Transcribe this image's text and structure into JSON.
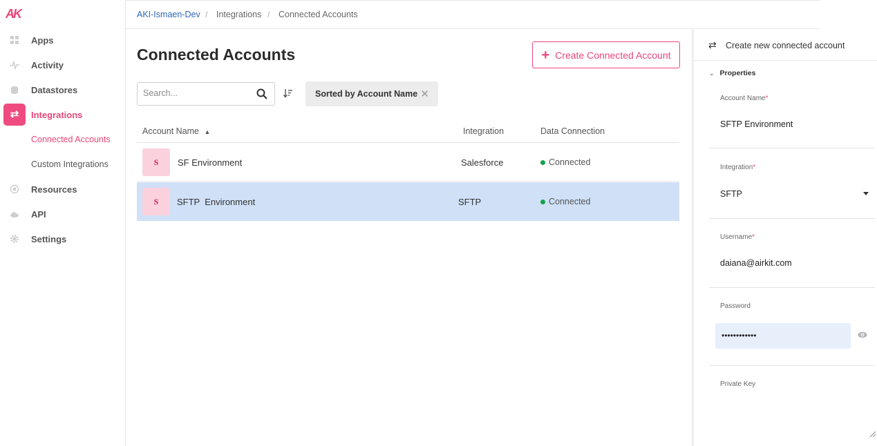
{
  "brand": {
    "logo": "AK",
    "accent": "#e9467a"
  },
  "sidebar": {
    "items": [
      {
        "label": "Apps",
        "icon": "grid-icon"
      },
      {
        "label": "Activity",
        "icon": "pulse-icon"
      },
      {
        "label": "Datastores",
        "icon": "database-icon"
      },
      {
        "label": "Integrations",
        "icon": "swap-arrows-icon"
      },
      {
        "label": "Resources",
        "icon": "globe-icon"
      },
      {
        "label": "API",
        "icon": "cloud-icon"
      },
      {
        "label": "Settings",
        "icon": "gear-icon"
      }
    ],
    "sub_items": [
      {
        "label": "Connected Accounts"
      },
      {
        "label": "Custom Integrations"
      }
    ]
  },
  "breadcrumb": {
    "workspace": "AKI-Ismaen-Dev",
    "section": "Integrations",
    "page": "Connected Accounts",
    "separator": "/"
  },
  "main": {
    "title": "Connected Accounts",
    "create_button": "Create Connected Account",
    "search_placeholder": "Search...",
    "sort_chip": "Sorted by Account Name",
    "table": {
      "columns": [
        "Account Name",
        "Integration",
        "Data Connection"
      ],
      "rows": [
        {
          "avatar": "S",
          "name": "SF Environment",
          "integration": "Salesforce",
          "status": "Connected"
        },
        {
          "avatar": "S",
          "name": "SFTP  Environment",
          "integration": "SFTP",
          "status": "Connected"
        }
      ]
    }
  },
  "panel": {
    "title": "Create new connected account",
    "section": "Properties",
    "fields": {
      "account_name": {
        "label": "Account Name",
        "value": "SFTP Environment"
      },
      "integration": {
        "label": "Integration",
        "value": "SFTP"
      },
      "username": {
        "label": "Username",
        "value": "daiana@airkit.com"
      },
      "password": {
        "label": "Password",
        "value": "••••••••••••"
      },
      "private_key": {
        "label": "Private Key",
        "value": ""
      }
    },
    "required_mark": "*"
  }
}
